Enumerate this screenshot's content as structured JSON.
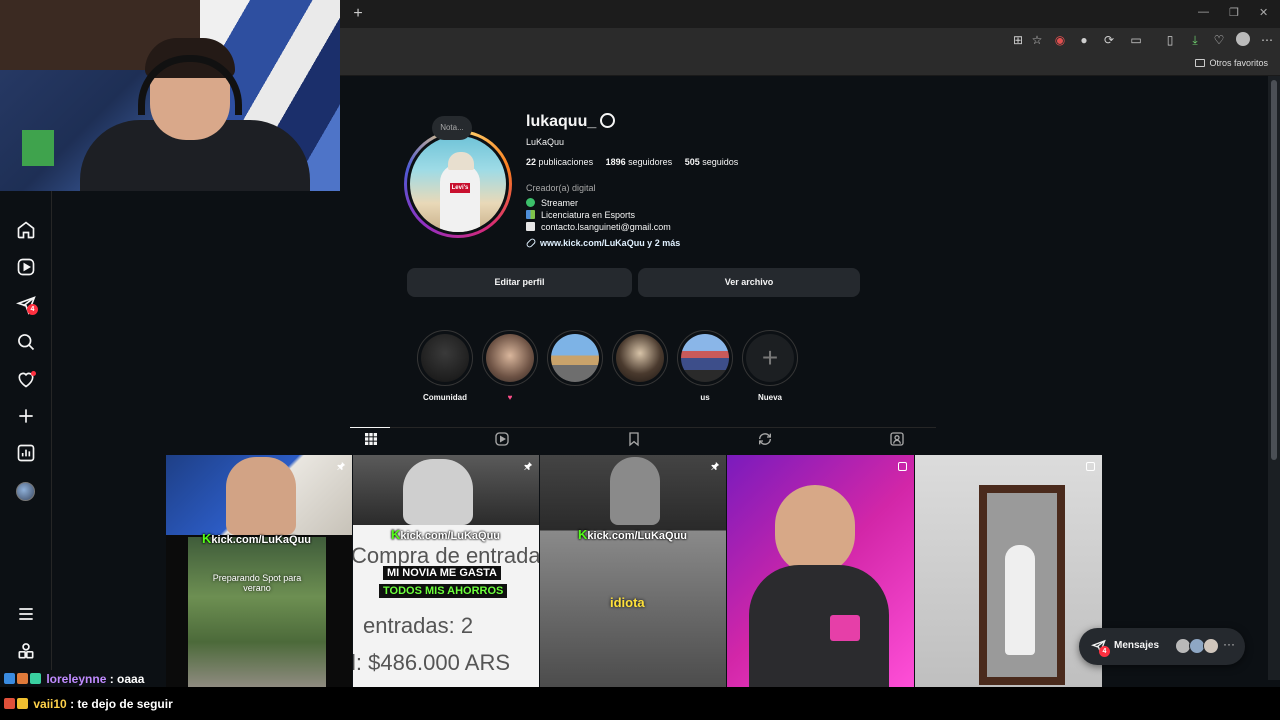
{
  "browser": {
    "new_tab": "+",
    "window_controls": [
      "—",
      "❐",
      "✕"
    ],
    "favorites_label": "Otros favoritos"
  },
  "sidebar": {
    "items": [
      {
        "icon": "home-icon"
      },
      {
        "icon": "reels-icon"
      },
      {
        "icon": "messages-icon",
        "badge": "4"
      },
      {
        "icon": "search-icon"
      },
      {
        "icon": "notifications-heart-icon"
      },
      {
        "icon": "create-plus-icon"
      },
      {
        "icon": "dashboard-icon"
      },
      {
        "icon": "profile-avatar-icon"
      }
    ],
    "bottom_items": [
      {
        "icon": "menu-icon"
      },
      {
        "icon": "threads-apps-icon"
      }
    ]
  },
  "profile": {
    "note": "Nota...",
    "username": "lukaquu_",
    "full_name": "LuKaQuu",
    "stats": {
      "posts_count": "22",
      "posts_label": "publicaciones",
      "followers_count": "1896",
      "followers_label": "seguidores",
      "following_count": "505",
      "following_label": "seguidos"
    },
    "category": "Creador(a) digital",
    "bio": [
      "Streamer",
      "Licenciatura en Esports",
      "contacto.lsanguineti@gmail.com"
    ],
    "link": "www.kick.com/LuKaQuu y 2 más",
    "buttons": {
      "edit": "Editar perfil",
      "archive": "Ver archivo"
    }
  },
  "highlights": [
    {
      "label": "Comunidad"
    },
    {
      "label": "♥"
    },
    {
      "label": ""
    },
    {
      "label": ""
    },
    {
      "label": "us"
    },
    {
      "label": "Nueva"
    }
  ],
  "tabs": [
    {
      "icon": "grid-icon",
      "active": true
    },
    {
      "icon": "reels-tab-icon"
    },
    {
      "icon": "saved-bookmark-icon"
    },
    {
      "icon": "reposts-icon"
    },
    {
      "icon": "tagged-icon"
    }
  ],
  "posts": [
    {
      "kick": "kick.com/LuKaQuu",
      "caption": "Preparando Spot para verano",
      "pinned": true
    },
    {
      "kick": "kick.com/LuKaQuu",
      "caption_top": "MI NOVIA ME GASTA",
      "caption_bottom": "TODOS MIS AHORROS",
      "bg_text_1": "Compra de entrada",
      "bg_text_2": "entradas: 2",
      "bg_text_3": "l: $486.000 ARS",
      "pinned": true
    },
    {
      "kick": "kick.com/LuKaQuu",
      "caption": "idiota",
      "pinned": true
    },
    {
      "caption": "",
      "multi": true
    },
    {
      "caption": "",
      "multi": true
    }
  ],
  "messages_pill": {
    "label": "Mensajes",
    "badge": "4",
    "more": "···"
  },
  "chat": [
    {
      "user": "loreleynne",
      "message": ": oaaa"
    },
    {
      "user": "vaii10",
      "message": ": te dejo de seguir"
    }
  ]
}
